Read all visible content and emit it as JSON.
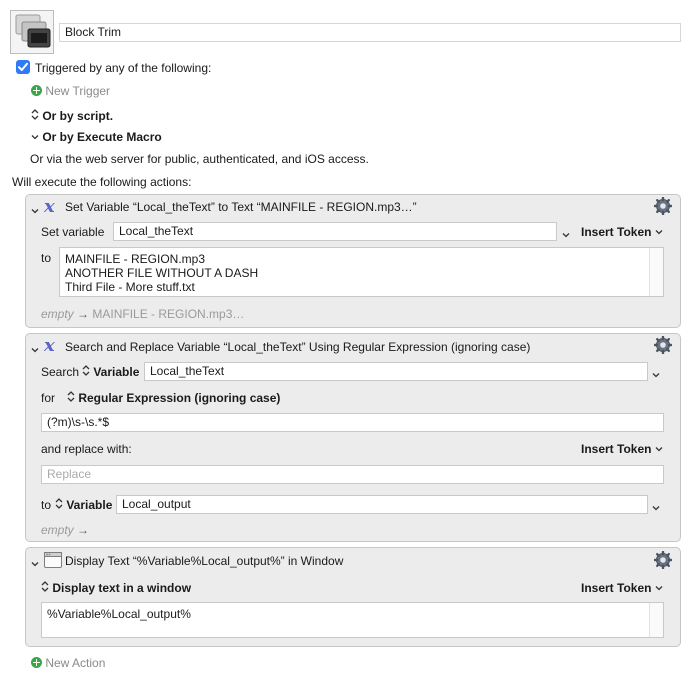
{
  "macro": {
    "name": "Block Trim"
  },
  "triggers": {
    "checkbox_label": "Triggered by any of the following:",
    "new_trigger": "New Trigger",
    "by_script": "Or by script.",
    "by_execute_macro": "Or by Execute Macro",
    "web_server": "Or via the web server for public, authenticated, and iOS access."
  },
  "actions_header": "Will execute the following actions:",
  "action1": {
    "title": "Set Variable “Local_theText” to Text “MAINFILE - REGION.mp3…”",
    "set_variable_label": "Set variable",
    "variable_value": "Local_theText",
    "insert_token": "Insert Token",
    "to_label": "to",
    "text_lines": [
      "MAINFILE - REGION.mp3",
      "ANOTHER FILE WITHOUT A DASH",
      "Third File - More stuff.txt"
    ],
    "result_empty": "empty",
    "result_arrow": "→",
    "result_value": "MAINFILE - REGION.mp3…"
  },
  "action2": {
    "title": "Search and Replace Variable “Local_theText” Using Regular Expression (ignoring case)",
    "search_label": "Search",
    "search_type": "Variable",
    "search_value": "Local_theText",
    "for_label": "for",
    "for_type": "Regular Expression (ignoring case)",
    "regex_value": "(?m)\\s-\\s.*$",
    "replace_label": "and replace with:",
    "insert_token": "Insert Token",
    "replace_placeholder": "Replace",
    "to_label": "to",
    "to_type": "Variable",
    "to_value": "Local_output",
    "result_empty": "empty",
    "result_arrow": "→"
  },
  "action3": {
    "title": "Display Text “%Variable%Local_output%” in Window",
    "mode": "Display text in a window",
    "insert_token": "Insert Token",
    "text_value": "%Variable%Local_output%"
  },
  "new_action": "New Action",
  "colors": {
    "checkbox_blue": "#2f7bf5",
    "panel_bg": "#ececec",
    "x_icon": "#5b64c8",
    "green_plus": "#3aa64a"
  }
}
